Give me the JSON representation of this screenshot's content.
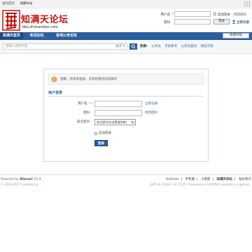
{
  "topbar": {
    "links": [
      "设为首页",
      "收藏本站"
    ],
    "menu_icon": "☰"
  },
  "logo": {
    "name": "知满天论坛",
    "domain": "bbs.zhimantian.com",
    "seal_icon": "seal-icon"
  },
  "header_login": {
    "username_label": "用户名",
    "username_marker": "▾",
    "password_label": "密码",
    "auto_login_label": "自动登录",
    "forgot_password": "找回密码",
    "login_button": "登录",
    "register_link": "立即注册"
  },
  "nav": {
    "tabs": [
      "知满天首页",
      "考试论坛",
      "各地公考论坛"
    ],
    "quick_nav": "快捷导航"
  },
  "search": {
    "placeholder": "请输入搜索内容",
    "type_label": "帖子",
    "type_arrow": "▾",
    "hot_label": "热搜:",
    "hot_terms": [
      "公务员",
      "京省新考",
      "公务员面试",
      "政选干部"
    ]
  },
  "panel": {
    "notice": "抱歉，您尚未登录，没有权限访问该版块",
    "title": "用户登录",
    "username_label": "用户名 :",
    "username_marker": "▾",
    "register_link": "立即注册",
    "password_label": "密码 :",
    "forgot_link": "找回密码",
    "question_label": "安全提问 :",
    "question_value": "安全提问(未设置请忽略)",
    "auto_login": "自动登录",
    "submit": "登录"
  },
  "footer": {
    "powered_prefix": "Powered by",
    "brand": "Discuz!",
    "version": "X3.4",
    "copyright": "© 2001-2017 Comsenz Inc.",
    "links": [
      "Archiver",
      "手机版",
      "小黑屋",
      "知满天论坛",
      "站长统计"
    ],
    "time": "GMT+8, 2019-7-26 17:45 , Processed in 0.027641 second(s), 4 queries ."
  },
  "colors": {
    "brand_red": "#c4120f",
    "nav_blue": "#2b5f9f",
    "link_blue": "#336699"
  }
}
